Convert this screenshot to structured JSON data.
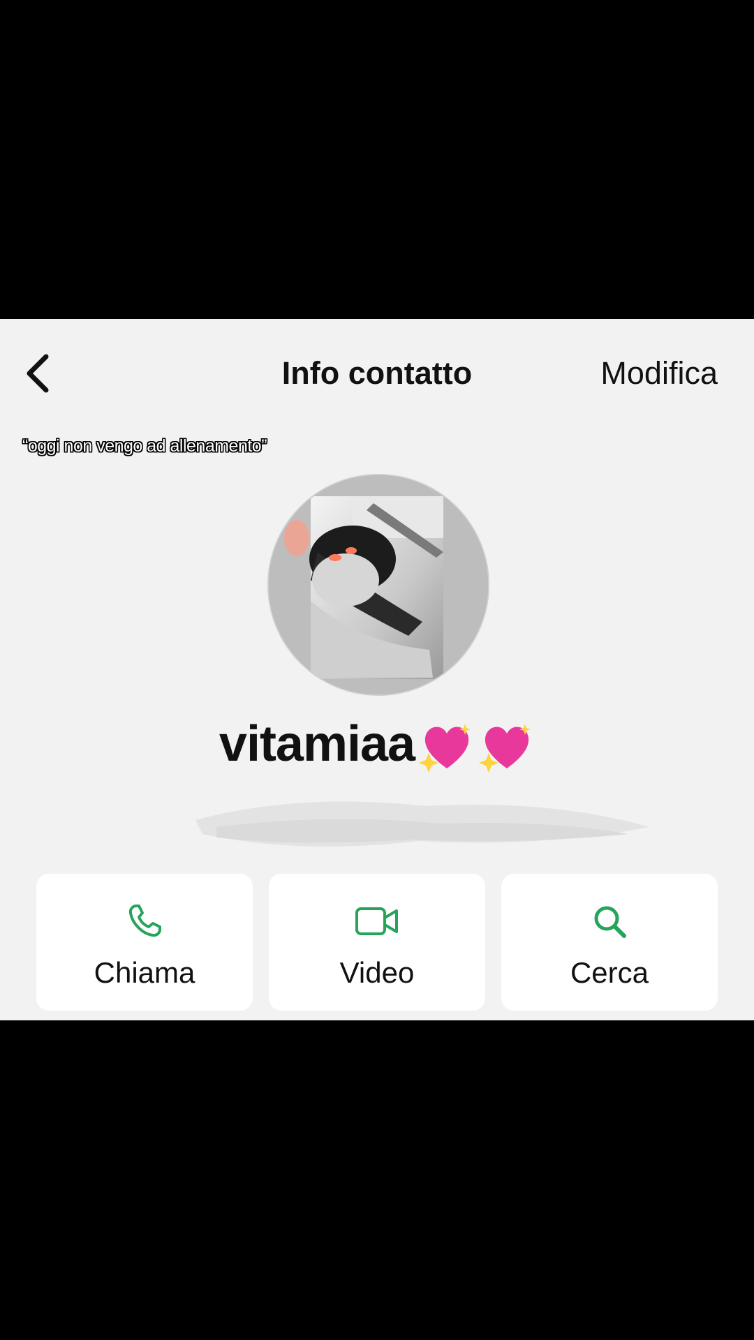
{
  "nav": {
    "back_icon": "chevron-left-icon",
    "title": "Info contatto",
    "edit_label": "Modifica"
  },
  "caption": "“oggi non vengo ad allenamento”",
  "contact": {
    "name": "vitamiaa",
    "name_emoji": [
      "sparkling-heart-icon",
      "sparkling-heart-icon"
    ]
  },
  "actions": [
    {
      "label": "Chiama",
      "icon": "phone-icon"
    },
    {
      "label": "Video",
      "icon": "video-camera-icon"
    },
    {
      "label": "Cerca",
      "icon": "search-icon"
    }
  ],
  "colors": {
    "accent": "#25a45a",
    "panel_bg": "#f2f2f2",
    "card_bg": "#ffffff",
    "heart": "#e8389c"
  }
}
